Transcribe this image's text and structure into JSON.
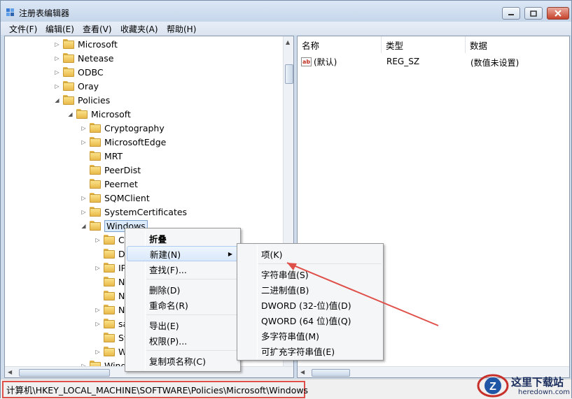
{
  "window": {
    "title": "注册表编辑器"
  },
  "menubar": [
    "文件(F)",
    "编辑(E)",
    "查看(V)",
    "收藏夹(A)",
    "帮助(H)"
  ],
  "tree": [
    {
      "label": "Microsoft",
      "level": 0,
      "arrow": "▷"
    },
    {
      "label": "Netease",
      "level": 0,
      "arrow": "▷"
    },
    {
      "label": "ODBC",
      "level": 0,
      "arrow": "▷"
    },
    {
      "label": "Oray",
      "level": 0,
      "arrow": "▷"
    },
    {
      "label": "Policies",
      "level": 0,
      "arrow": "◢"
    },
    {
      "label": "Microsoft",
      "level": 1,
      "arrow": "◢"
    },
    {
      "label": "Cryptography",
      "level": 2,
      "arrow": "▷"
    },
    {
      "label": "MicrosoftEdge",
      "level": 2,
      "arrow": "▷"
    },
    {
      "label": "MRT",
      "level": 2,
      "arrow": ""
    },
    {
      "label": "PeerDist",
      "level": 2,
      "arrow": ""
    },
    {
      "label": "Peernet",
      "level": 2,
      "arrow": ""
    },
    {
      "label": "SQMClient",
      "level": 2,
      "arrow": "▷"
    },
    {
      "label": "SystemCertificates",
      "level": 2,
      "arrow": "▷"
    },
    {
      "label": "Windows",
      "level": 2,
      "arrow": "◢",
      "selected": true
    },
    {
      "label": "Cu",
      "level": 3,
      "arrow": "▷"
    },
    {
      "label": "Da",
      "level": 3,
      "arrow": ""
    },
    {
      "label": "IP",
      "level": 3,
      "arrow": "▷"
    },
    {
      "label": "Ne",
      "level": 3,
      "arrow": ""
    },
    {
      "label": "Ne",
      "level": 3,
      "arrow": ""
    },
    {
      "label": "Ne",
      "level": 3,
      "arrow": "▷"
    },
    {
      "label": "sa",
      "level": 3,
      "arrow": "▷"
    },
    {
      "label": "Sy",
      "level": 3,
      "arrow": ""
    },
    {
      "label": "W",
      "level": 3,
      "arrow": "▷"
    },
    {
      "label": "Windo",
      "level": 2,
      "arrow": "▷"
    }
  ],
  "list": {
    "headers": [
      "名称",
      "类型",
      "数据"
    ],
    "rows": [
      {
        "name": "(默认)",
        "type": "REG_SZ",
        "data": "(数值未设置)",
        "icon": "ab"
      }
    ]
  },
  "context_menu": {
    "items": [
      {
        "label": "折叠",
        "bold": true
      },
      {
        "label": "新建(N)",
        "submenu": true,
        "highlight": true
      },
      {
        "label": "查找(F)..."
      },
      {
        "sep": true
      },
      {
        "label": "删除(D)"
      },
      {
        "label": "重命名(R)"
      },
      {
        "sep": true
      },
      {
        "label": "导出(E)"
      },
      {
        "label": "权限(P)..."
      },
      {
        "sep": true
      },
      {
        "label": "复制项名称(C)"
      }
    ]
  },
  "submenu": {
    "items": [
      {
        "label": "项(K)"
      },
      {
        "sep": true
      },
      {
        "label": "字符串值(S)"
      },
      {
        "label": "二进制值(B)"
      },
      {
        "label": "DWORD (32-位)值(D)"
      },
      {
        "label": "QWORD (64 位)值(Q)"
      },
      {
        "label": "多字符串值(M)"
      },
      {
        "label": "可扩充字符串值(E)"
      }
    ]
  },
  "status": {
    "path": "计算机\\HKEY_LOCAL_MACHINE\\SOFTWARE\\Policies\\Microsoft\\Windows"
  },
  "watermark": {
    "title": "这里下载站",
    "url": "heredown.com",
    "letter": "Z"
  },
  "colors": {
    "annotation": "#e0504a",
    "selection": "#dcebfc",
    "menu_highlight": "#d9e8fb"
  }
}
